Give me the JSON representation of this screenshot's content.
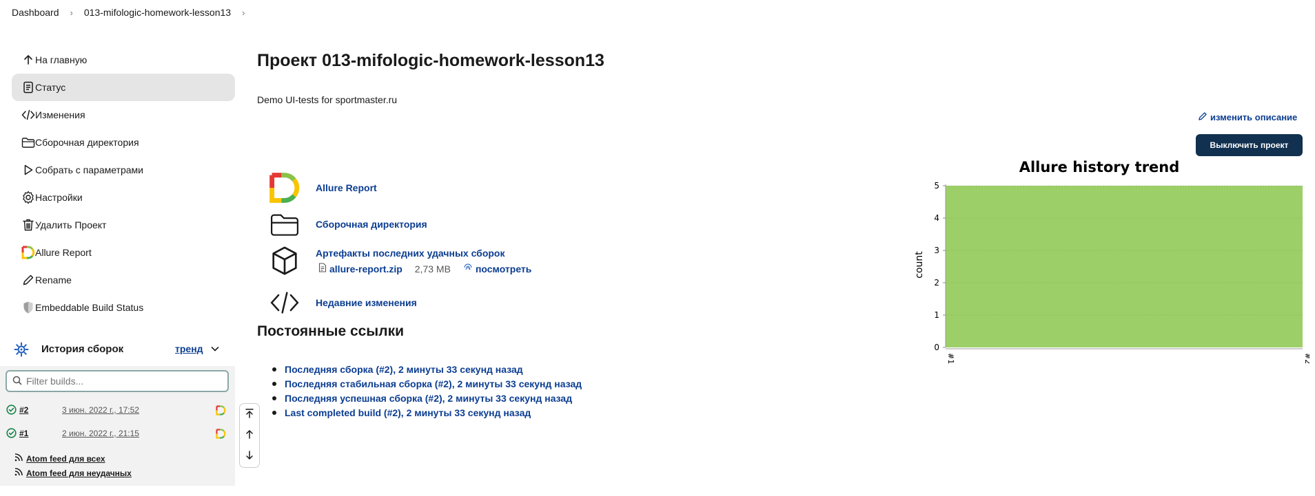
{
  "breadcrumb": {
    "items": [
      "Dashboard",
      "013-mifologic-homework-lesson13"
    ]
  },
  "sidebar": {
    "items": [
      {
        "label": "На главную",
        "icon": "arrow-up-icon"
      },
      {
        "label": "Статус",
        "icon": "document-icon",
        "active": true
      },
      {
        "label": "Изменения",
        "icon": "code-icon"
      },
      {
        "label": "Сборочная директория",
        "icon": "folder-icon"
      },
      {
        "label": "Собрать с параметрами",
        "icon": "play-icon"
      },
      {
        "label": "Настройки",
        "icon": "gear-icon"
      },
      {
        "label": "Удалить Проект",
        "icon": "trash-icon"
      },
      {
        "label": "Allure Report",
        "icon": "allure-icon"
      },
      {
        "label": "Rename",
        "icon": "pencil-icon"
      },
      {
        "label": "Embeddable Build Status",
        "icon": "shield-icon"
      }
    ]
  },
  "build_history": {
    "title": "История сборок",
    "trend_label": "тренд",
    "filter_placeholder": "Filter builds...",
    "builds": [
      {
        "number": "#2",
        "date": "3 июн. 2022 г., 17:52",
        "status": "success"
      },
      {
        "number": "#1",
        "date": "2 июн. 2022 г., 21:15",
        "status": "success"
      }
    ],
    "feeds": [
      "Atom feed для всех",
      "Atom feed для неудачных"
    ]
  },
  "main": {
    "title": "Проект 013-mifologic-homework-lesson13",
    "description": "Demo UI-tests for sportmaster.ru",
    "edit_description": "изменить описание",
    "disable_button": "Выключить проект",
    "actions": [
      {
        "label": "Allure Report",
        "icon": "allure-icon"
      },
      {
        "label": "Сборочная директория",
        "icon": "folder-icon"
      },
      {
        "label": "Артефакты последних удачных сборок",
        "icon": "box-icon"
      },
      {
        "label": "Недавние изменения",
        "icon": "code-icon"
      }
    ],
    "artifact": {
      "file": "allure-report.zip",
      "size": "2,73 MB",
      "view": "посмотреть"
    },
    "permalinks_title": "Постоянные ссылки",
    "permalinks": [
      "Последняя сборка (#2), 2 минуты 33 секунд назад",
      "Последняя стабильная сборка (#2), 2 минуты 33 секунд назад",
      "Последняя успешная сборка (#2), 2 минуты 33 секунд назад",
      "Last completed build (#2), 2 минуты 33 секунд назад"
    ]
  },
  "chart_data": {
    "type": "area",
    "title": "Allure history trend",
    "xlabel": "",
    "ylabel": "count",
    "categories": [
      "#1",
      "#2"
    ],
    "series": [
      {
        "values": [
          5,
          5
        ],
        "color": "#9dcf68"
      }
    ],
    "ylim": [
      0,
      5
    ],
    "yticks": [
      0,
      1,
      2,
      3,
      4,
      5
    ],
    "grid": true
  }
}
